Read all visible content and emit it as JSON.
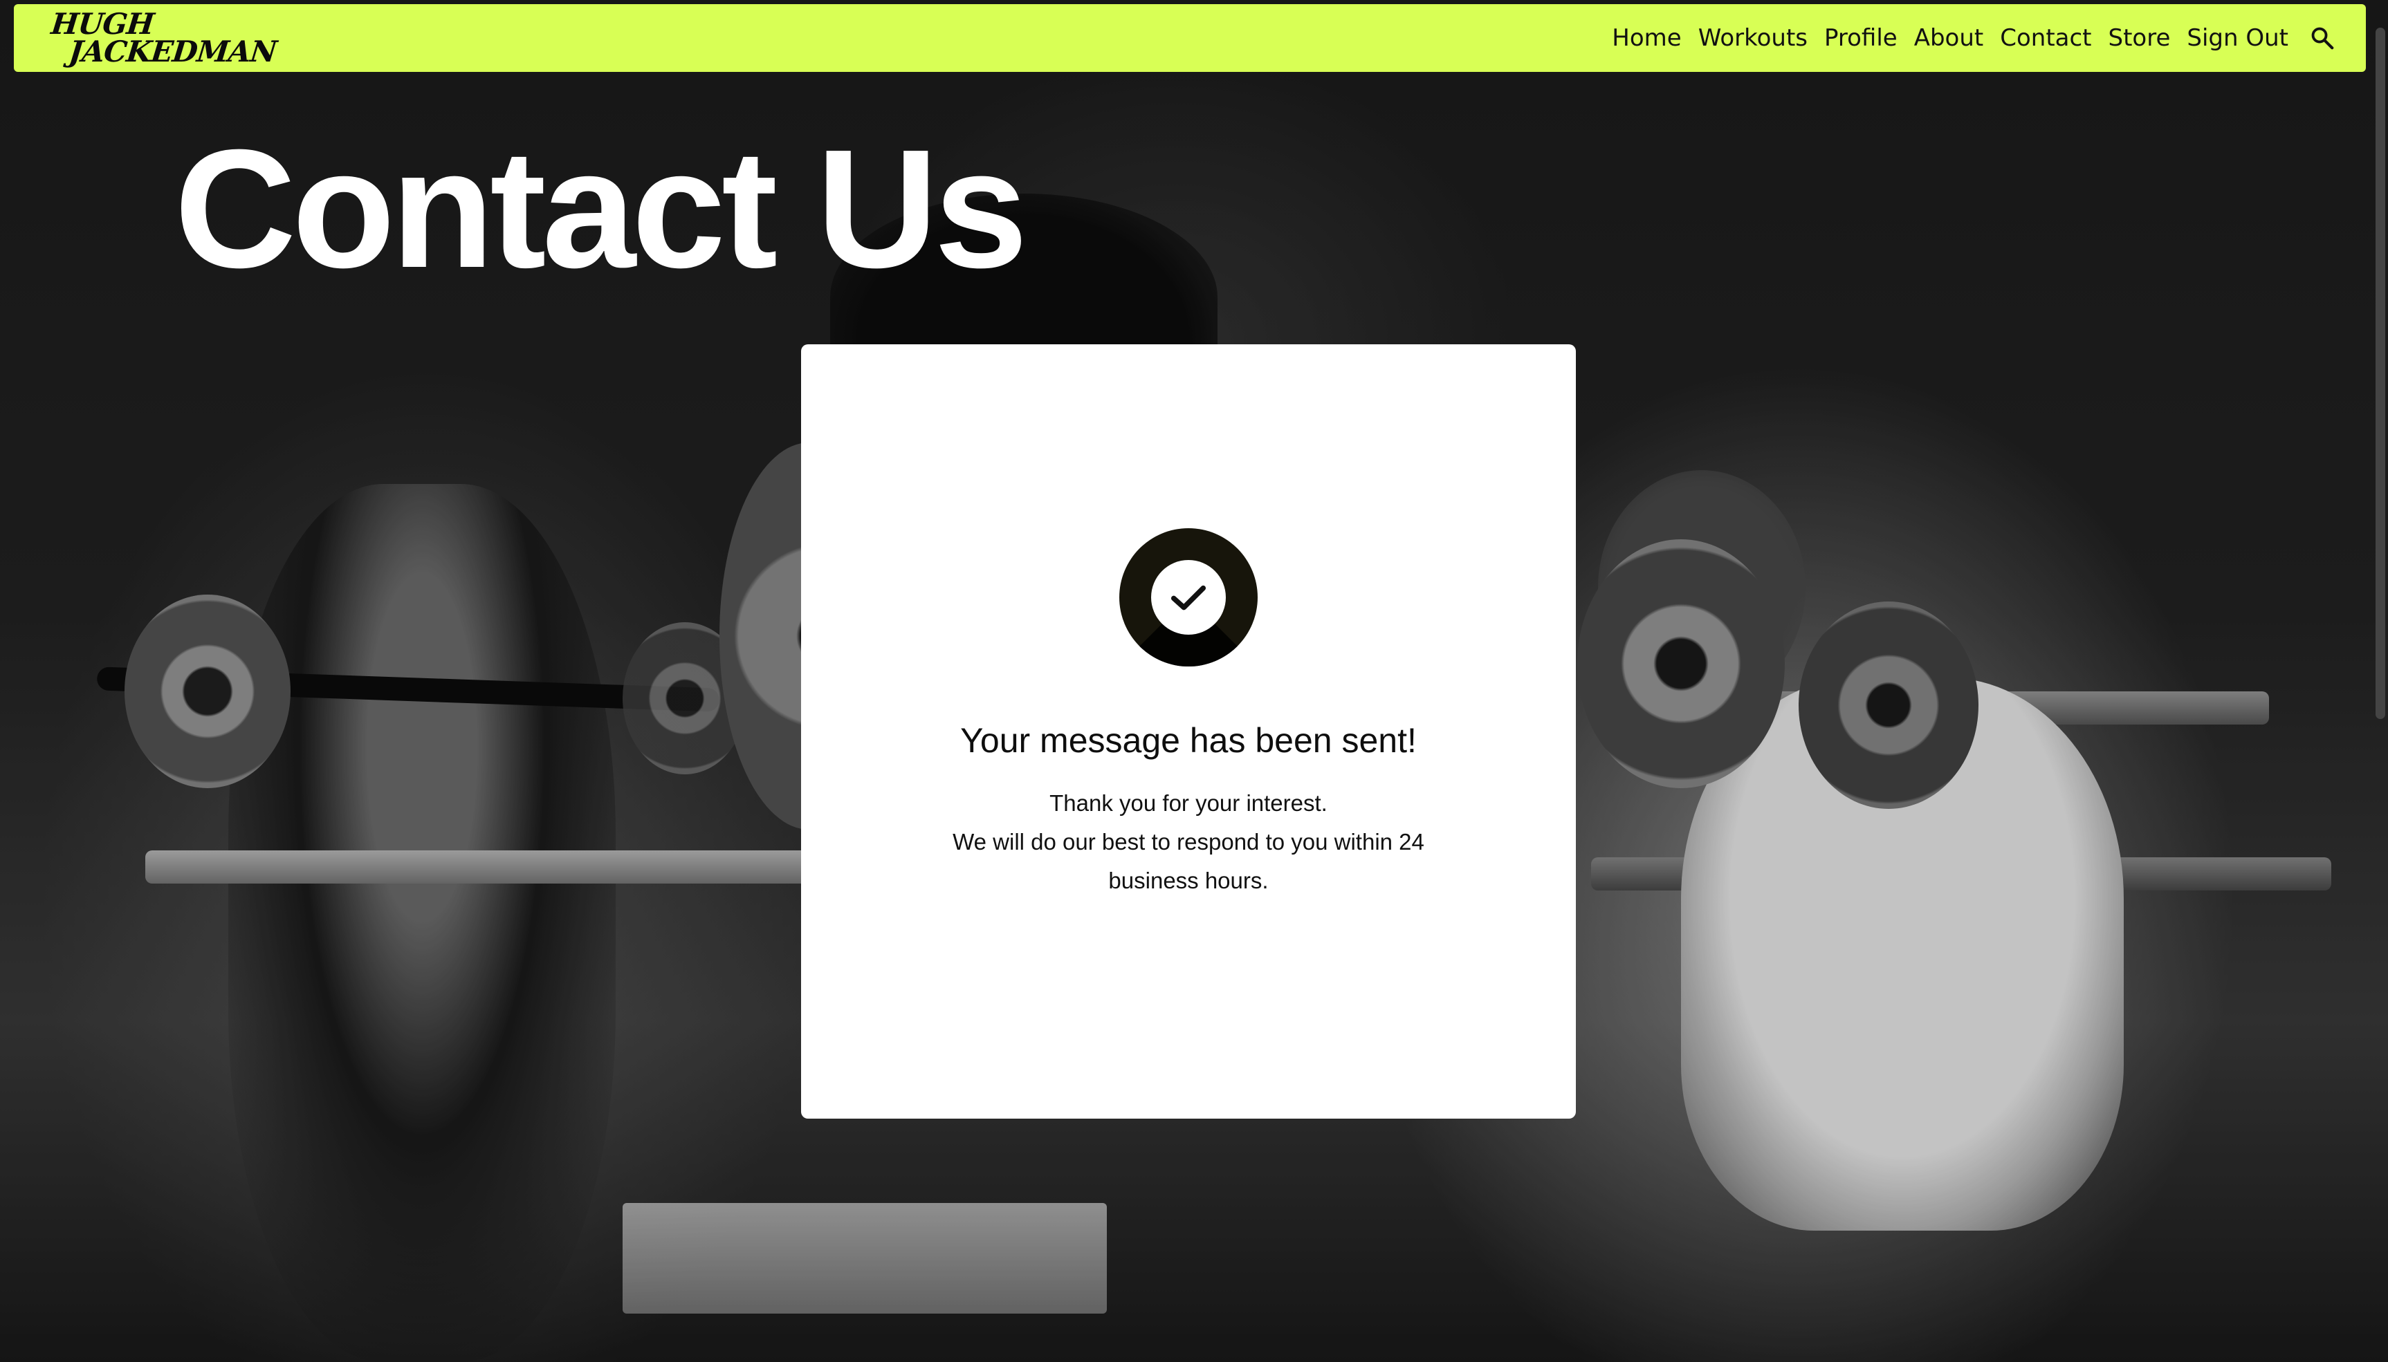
{
  "navbar": {
    "logo_line1": "Hugh",
    "logo_line2": "Jackedman",
    "links": [
      "Home",
      "Workouts",
      "Profile",
      "About",
      "Contact",
      "Store",
      "Sign Out"
    ],
    "search_icon": "search-icon",
    "accent_color": "#d8ff55"
  },
  "hero": {
    "title": "Contact Us"
  },
  "confirmation": {
    "icon": "check-circle-icon",
    "heading": "Your message has been sent!",
    "line1": "Thank you for your interest.",
    "line2": "We will do our best to respond to you within 24 business hours."
  }
}
